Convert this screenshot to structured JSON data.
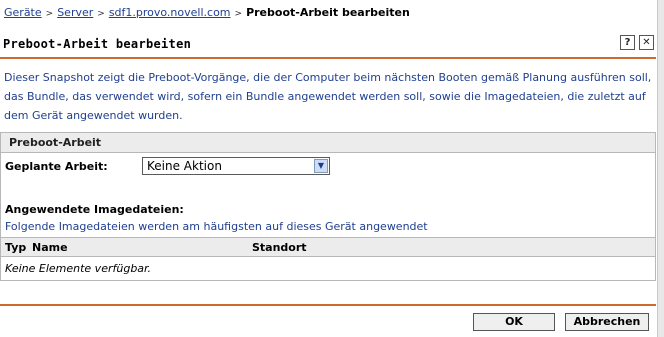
{
  "breadcrumb": {
    "items": [
      "Geräte",
      "Server",
      "sdf1.provo.novell.com"
    ],
    "current": "Preboot-Arbeit bearbeiten"
  },
  "header": {
    "title": "Preboot-Arbeit bearbeiten",
    "help_label": "?",
    "close_label": "✕"
  },
  "description": "Dieser Snapshot zeigt die Preboot-Vorgänge, die der Computer beim nächsten Booten gemäß Planung ausführen soll, das Bundle, das verwendet wird, sofern ein Bundle angewendet werden soll, sowie die Imagedateien, die zuletzt auf dem Gerät angewendet wurden.",
  "section": {
    "title": "Preboot-Arbeit",
    "field_label": "Geplante Arbeit:",
    "select_value": "Keine Aktion",
    "list_title": "Angewendete Imagedateien:",
    "list_subtitle": "Folgende Imagedateien werden am häufigsten auf dieses Gerät angewendet",
    "columns": [
      "Typ",
      "Name",
      "Standort"
    ],
    "empty_text": "Keine Elemente verfügbar."
  },
  "footer": {
    "ok_label": "OK",
    "cancel_label": "Abbrechen"
  },
  "colors": {
    "accent_rule": "#cf6a2c",
    "link": "#1f3f8f"
  }
}
